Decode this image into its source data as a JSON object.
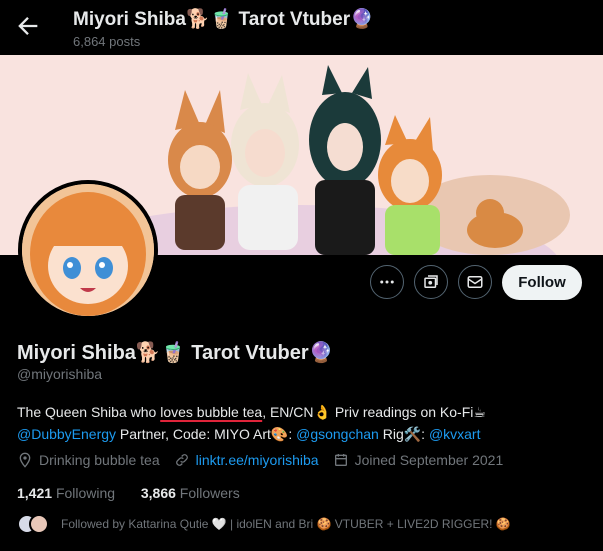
{
  "header": {
    "title": "Miyori Shiba🐕🧋 Tarot Vtuber🔮",
    "posts": "6,864 posts"
  },
  "profile": {
    "name": "Miyori Shiba🐕🧋 Tarot Vtuber🔮",
    "handle": "@miyorishiba",
    "follow_label": "Follow"
  },
  "bio": {
    "p1": "The Queen Shiba who ",
    "p2": "loves bubble tea",
    "p3": ", EN/CN👌 Priv readings on Ko-Fi☕",
    "link1": "@DubbyEnergy",
    "p4": " Partner, Code: MIYO Art🎨: ",
    "link2": "@gsongchan",
    "p5": " Rig🛠️: ",
    "link3": "@kvxart"
  },
  "meta": {
    "location": "Drinking bubble tea",
    "website": "linktr.ee/miyorishiba",
    "joined": "Joined September 2021"
  },
  "stats": {
    "following_count": "1,421",
    "following_label": "Following",
    "followers_count": "3,866",
    "followers_label": "Followers"
  },
  "followed_by": "Followed by Kattarina Qutie 🤍 | idolEN and Bri 🍪 VTUBER + LIVE2D RIGGER! 🍪",
  "colors": {
    "accent": "#1d9bf0",
    "background": "#000000",
    "muted_text": "#71767b",
    "follow_button_bg": "#eff3f4"
  },
  "icons": [
    "back-arrow-icon",
    "more-icon",
    "subscribe-icon",
    "message-icon",
    "location-icon",
    "link-icon",
    "calendar-icon"
  ]
}
